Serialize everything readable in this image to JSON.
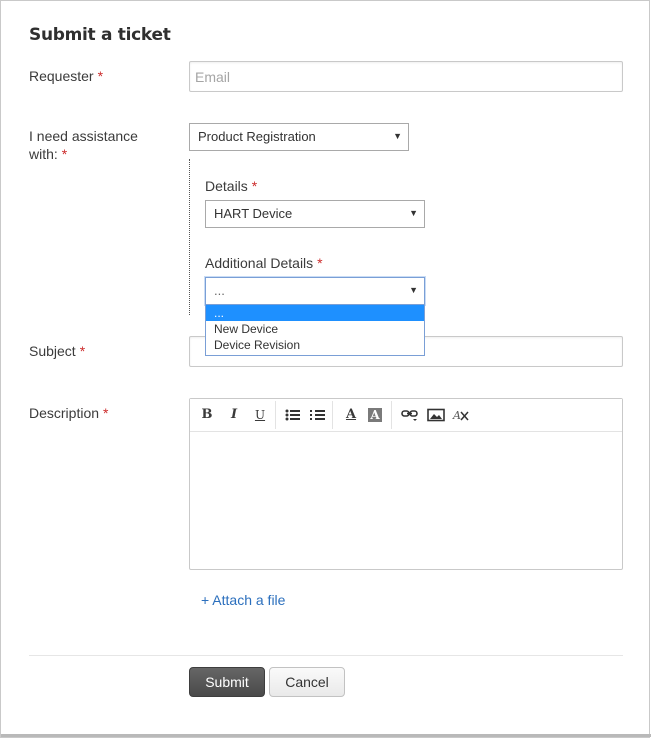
{
  "form": {
    "title": "Submit a ticket",
    "required_marker": "*"
  },
  "requester": {
    "label": "Requester",
    "placeholder": "Email",
    "value": ""
  },
  "assistance": {
    "label_line1": "I need assistance",
    "label_line2": "with:",
    "selected": "Product Registration"
  },
  "details": {
    "label": "Details",
    "selected": "HART Device"
  },
  "additional_details": {
    "label": "Additional Details",
    "selected": "...",
    "options": [
      "...",
      "New Device",
      "Device Revision"
    ],
    "highlighted_index": 0
  },
  "subject": {
    "label": "Subject",
    "value": ""
  },
  "description": {
    "label": "Description",
    "value": "",
    "toolbar": [
      {
        "name": "bold-button",
        "icon": "bold-icon",
        "glyph": "B"
      },
      {
        "name": "italic-button",
        "icon": "italic-icon",
        "glyph": "I"
      },
      {
        "name": "underline-button",
        "icon": "underline-icon",
        "glyph": "U"
      },
      {
        "name": "bulleted-list-button",
        "icon": "bulleted-list-icon"
      },
      {
        "name": "numbered-list-button",
        "icon": "numbered-list-icon"
      },
      {
        "name": "text-color-button",
        "icon": "text-color-icon",
        "glyph": "A"
      },
      {
        "name": "highlight-color-button",
        "icon": "highlight-icon",
        "glyph": "A"
      },
      {
        "name": "insert-link-button",
        "icon": "link-icon"
      },
      {
        "name": "insert-image-button",
        "icon": "image-icon"
      },
      {
        "name": "clear-formatting-button",
        "icon": "clear-format-icon"
      }
    ]
  },
  "attach": {
    "label": "+ Attach a file"
  },
  "actions": {
    "submit_label": "Submit",
    "cancel_label": "Cancel"
  },
  "colors": {
    "required": "#cc2b2b",
    "link": "#2b6fbd",
    "highlight": "#1e90ff",
    "submit_bg": "#555555"
  }
}
